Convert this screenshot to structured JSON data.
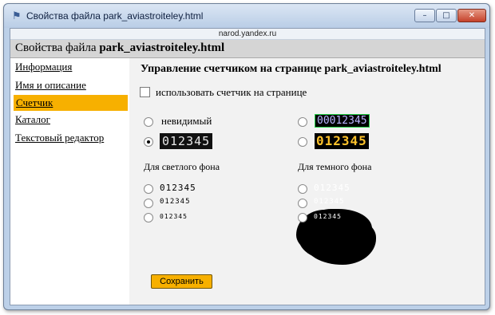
{
  "window": {
    "title": "Свойства файла park_aviastroiteley.html",
    "address": "narod.yandex.ru",
    "controls": {
      "minimize": "–",
      "maximize": "□",
      "close": "✕"
    }
  },
  "header": {
    "prefix": "Свойства файла ",
    "filename": "park_aviastroiteley.html"
  },
  "sidebar": {
    "items": [
      {
        "label": "Информация"
      },
      {
        "label": "Имя и описание"
      },
      {
        "label": "Счетчик"
      },
      {
        "label": "Каталог"
      },
      {
        "label": "Текстовый редактор"
      }
    ],
    "active_index": 2
  },
  "main": {
    "heading": "Управление счетчиком на странице park_aviastroiteley.html",
    "use_counter_label": "использовать счетчик на странице",
    "use_counter_checked": false,
    "invisible_label": "невидимый",
    "counter_value": "012345",
    "lcd_value": "00012345",
    "light_bg_label": "Для светлого фона",
    "dark_bg_label": "Для темного фона",
    "save_label": "Сохранить"
  },
  "colors": {
    "accent": "#f7b000",
    "header_bg": "#d5d5d5",
    "main_bg": "#f2f2f2",
    "lcd_border": "#26d34a",
    "lcd_text": "#b9b5ff",
    "yellow_digits": "#ffc22b"
  },
  "icons": {
    "app": "webpage-icon",
    "minimize": "minimize-icon",
    "maximize": "maximize-icon",
    "close": "close-icon"
  }
}
